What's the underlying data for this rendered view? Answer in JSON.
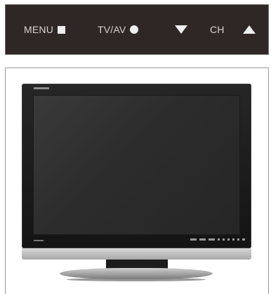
{
  "control_bar": {
    "menu_label": "MENU",
    "tvav_label": "TV/AV",
    "ch_label": "CH",
    "icons": {
      "menu": "square-icon",
      "tvav": "circle-icon",
      "ch_down": "triangle-down-icon",
      "ch_up": "triangle-up-icon"
    },
    "background_color": "#2f2726",
    "text_color": "#d6d2d1"
  },
  "product_image": {
    "subject": "tv-illustration"
  }
}
